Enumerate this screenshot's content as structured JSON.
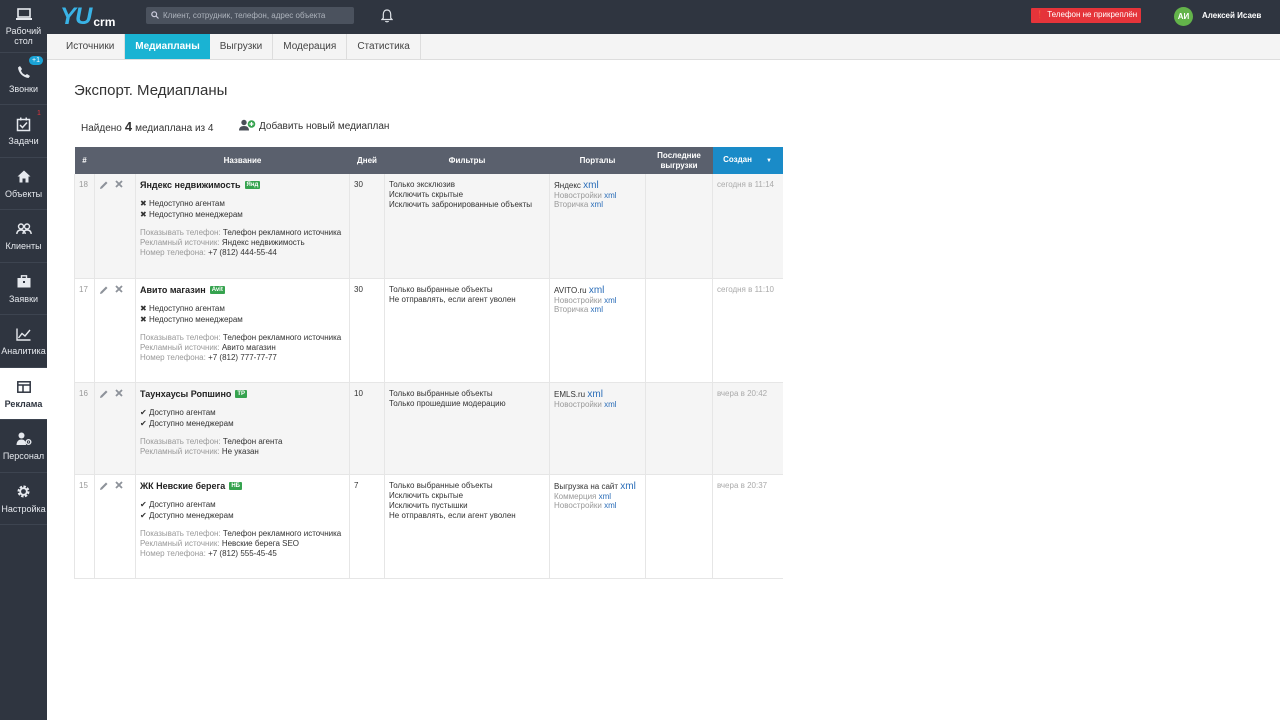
{
  "sidebar": {
    "items": [
      {
        "label": "Рабочий стол",
        "icon": "laptop-icon"
      },
      {
        "label": "Звонки",
        "icon": "phone-icon",
        "badge": "+1"
      },
      {
        "label": "Задачи",
        "icon": "tasks-icon",
        "badge": "1"
      },
      {
        "label": "Объекты",
        "icon": "home-icon"
      },
      {
        "label": "Клиенты",
        "icon": "users-icon"
      },
      {
        "label": "Заявки",
        "icon": "briefcase-icon"
      },
      {
        "label": "Аналитика",
        "icon": "chart-icon"
      },
      {
        "label": "Реклама",
        "icon": "ads-icon",
        "active": true
      },
      {
        "label": "Персонал",
        "icon": "staff-icon"
      },
      {
        "label": "Настройка",
        "icon": "gear-icon"
      }
    ]
  },
  "topbar": {
    "logo_main": "YU",
    "logo_sub": "crm",
    "search_placeholder": "Клиент, сотрудник, телефон, адрес объекта",
    "phone_warning": "Телефон не прикреплён",
    "avatar_initials": "АИ",
    "username": "Алексей Исаев"
  },
  "tabs": [
    "Источники",
    "Медиапланы",
    "Выгрузки",
    "Модерация",
    "Статистика"
  ],
  "page": {
    "title": "Экспорт. Медиапланы",
    "found_prefix": "Найдено",
    "found_count": "4",
    "found_suffix": "медиаплана из 4",
    "add_label": "Добавить новый медиаплан"
  },
  "table": {
    "headers": {
      "num": "#",
      "name": "Название",
      "days": "Дней",
      "filters": "Фильтры",
      "portals": "Порталы",
      "last": "Последние выгрузки",
      "created": "Создан"
    },
    "rows": [
      {
        "num": "18",
        "name": "Яндекс недвижимость",
        "tag": "Янд",
        "avail": [
          {
            "sym": "✖",
            "text": "Недоступно агентам"
          },
          {
            "sym": "✖",
            "text": "Недоступно менеджерам"
          }
        ],
        "meta": [
          {
            "label": "Показывать телефон:",
            "value": "Телефон рекламного источника"
          },
          {
            "label": "Рекламный источник:",
            "value": "Яндекс недвижимость"
          },
          {
            "label": "Номер телефона:",
            "value": "+7 (812) 444-55-44"
          }
        ],
        "days": "30",
        "filters": [
          "Только эксклюзив",
          "Исключить скрытые",
          "Исключить забронированные объекты"
        ],
        "portal_main": "Яндекс",
        "portal_subs": [
          "Новостройки",
          "Вторичка"
        ],
        "xml": "xml",
        "created": "сегодня в 11:14"
      },
      {
        "num": "17",
        "name": "Авито магазин",
        "tag": "Avit",
        "avail": [
          {
            "sym": "✖",
            "text": "Недоступно агентам"
          },
          {
            "sym": "✖",
            "text": "Недоступно менеджерам"
          }
        ],
        "meta": [
          {
            "label": "Показывать телефон:",
            "value": "Телефон рекламного источника"
          },
          {
            "label": "Рекламный источник:",
            "value": "Авито магазин"
          },
          {
            "label": "Номер телефона:",
            "value": "+7 (812) 777-77-77"
          }
        ],
        "days": "30",
        "filters": [
          "Только выбранные объекты",
          "Не отправлять, если агент уволен"
        ],
        "portal_main": "AVITO.ru",
        "portal_subs": [
          "Новостройки",
          "Вторичка"
        ],
        "xml": "xml",
        "created": "сегодня в 11:10"
      },
      {
        "num": "16",
        "name": "Таунхаусы Ропшино",
        "tag": "ТР",
        "avail": [
          {
            "sym": "✔",
            "text": "Доступно агентам"
          },
          {
            "sym": "✔",
            "text": "Доступно менеджерам"
          }
        ],
        "meta": [
          {
            "label": "Показывать телефон:",
            "value": "Телефон агента"
          },
          {
            "label": "Рекламный источник:",
            "value": "Не указан"
          }
        ],
        "days": "10",
        "filters": [
          "Только выбранные объекты",
          "Только прошедшие модерацию"
        ],
        "portal_main": "EMLS.ru",
        "portal_subs": [
          "Новостройки"
        ],
        "xml": "xml",
        "created": "вчера в 20:42"
      },
      {
        "num": "15",
        "name": "ЖК Невские берега",
        "tag": "НБ",
        "avail": [
          {
            "sym": "✔",
            "text": "Доступно агентам"
          },
          {
            "sym": "✔",
            "text": "Доступно менеджерам"
          }
        ],
        "meta": [
          {
            "label": "Показывать телефон:",
            "value": "Телефон рекламного источника"
          },
          {
            "label": "Рекламный источник:",
            "value": "Невские берега SEO"
          },
          {
            "label": "Номер телефона:",
            "value": "+7 (812) 555-45-45"
          }
        ],
        "days": "7",
        "filters": [
          "Только выбранные объекты",
          "Исключить скрытые",
          "Исключить пустышки",
          "Не отправлять, если агент уволен"
        ],
        "portal_main": "Выгрузка на сайт",
        "portal_subs": [
          "Коммерция",
          "Новостройки"
        ],
        "xml": "xml",
        "created": "вчера в 20:37"
      }
    ]
  }
}
